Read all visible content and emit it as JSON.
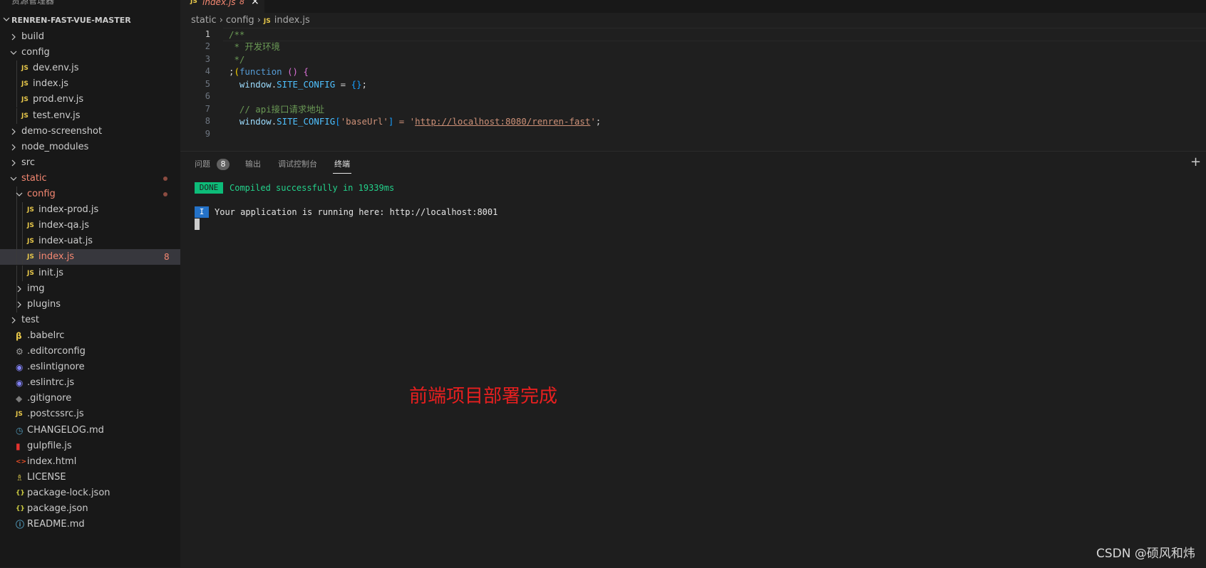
{
  "sidebar": {
    "title": "资源管理器",
    "more": "···",
    "root": "RENREN-FAST-VUE-MASTER",
    "items": [
      {
        "label": "build",
        "icon": "chevron-right-icon"
      },
      {
        "label": "config",
        "icon": "chevron-down-icon"
      },
      {
        "label": "dev.env.js",
        "icon": "js-file-icon",
        "icon_text": "JS"
      },
      {
        "label": "index.js",
        "icon": "js-file-icon",
        "icon_text": "JS"
      },
      {
        "label": "prod.env.js",
        "icon": "js-file-icon",
        "icon_text": "JS"
      },
      {
        "label": "test.env.js",
        "icon": "js-file-icon",
        "icon_text": "JS"
      },
      {
        "label": "demo-screenshot",
        "icon": "chevron-right-icon"
      },
      {
        "label": "node_modules",
        "icon": "chevron-right-icon"
      },
      {
        "label": "src",
        "icon": "chevron-right-icon"
      },
      {
        "label": "static",
        "icon": "chevron-down-icon",
        "modified": true
      },
      {
        "label": "config",
        "icon": "chevron-down-icon",
        "modified": true
      },
      {
        "label": "index-prod.js",
        "icon": "js-file-icon",
        "icon_text": "JS"
      },
      {
        "label": "index-qa.js",
        "icon": "js-file-icon",
        "icon_text": "JS"
      },
      {
        "label": "index-uat.js",
        "icon": "js-file-icon",
        "icon_text": "JS"
      },
      {
        "label": "index.js",
        "icon": "js-file-icon",
        "icon_text": "JS",
        "badge": "8"
      },
      {
        "label": "init.js",
        "icon": "js-file-icon",
        "icon_text": "JS"
      },
      {
        "label": "img",
        "icon": "chevron-right-icon"
      },
      {
        "label": "plugins",
        "icon": "chevron-right-icon"
      },
      {
        "label": "test",
        "icon": "chevron-right-icon"
      },
      {
        "label": ".babelrc",
        "icon": "babel-icon"
      },
      {
        "label": ".editorconfig",
        "icon": "gear-icon"
      },
      {
        "label": ".eslintignore",
        "icon": "eslint-icon"
      },
      {
        "label": ".eslintrc.js",
        "icon": "eslint-icon"
      },
      {
        "label": ".gitignore",
        "icon": "git-icon"
      },
      {
        "label": ".postcssrc.js",
        "icon": "js-file-icon",
        "icon_text": "JS"
      },
      {
        "label": "CHANGELOG.md",
        "icon": "clock-icon"
      },
      {
        "label": "gulpfile.js",
        "icon": "gulp-icon"
      },
      {
        "label": "index.html",
        "icon": "html-icon",
        "icon_text": "<>"
      },
      {
        "label": "LICENSE",
        "icon": "license-icon"
      },
      {
        "label": "package-lock.json",
        "icon": "json-icon",
        "icon_text": "{}"
      },
      {
        "label": "package.json",
        "icon": "json-icon",
        "icon_text": "{}"
      },
      {
        "label": "README.md",
        "icon": "info-icon"
      }
    ]
  },
  "editor": {
    "tab": {
      "icon_text": "JS",
      "label": "index.js",
      "badge": "8",
      "close": "×"
    },
    "breadcrumb": {
      "parts": [
        "static",
        "config"
      ],
      "file": "index.js",
      "file_icon_text": "JS"
    },
    "lines": [
      "1",
      "2",
      "3",
      "4",
      "5",
      "6",
      "7",
      "8",
      "9"
    ],
    "code": {
      "l1": "/**",
      "l2": " * 开发环境",
      "l3": " */",
      "l4a": ";",
      "l4b": "(",
      "l4c": "function",
      "l4d": " ",
      "l4e": "()",
      "l4f": " {",
      "l5a": "  window",
      "l5b": ".",
      "l5c": "SITE_CONFIG",
      "l5d": " = ",
      "l5e": "{}",
      "l5f": ";",
      "l7": "  // api接口请求地址",
      "l8a": "  window",
      "l8b": ".",
      "l8c": "SITE_CONFIG",
      "l8d": "[",
      "l8e": "'baseUrl'",
      "l8f": "]",
      "l8g": " = '",
      "l8h": "http://localhost:8080/renren-fast",
      "l8i": "'",
      "l8j": ";"
    }
  },
  "panel": {
    "tabs": {
      "problems": "问题",
      "problems_count": "8",
      "output": "输出",
      "debug": "调试控制台",
      "terminal": "终端"
    },
    "plus": "+",
    "terminal": {
      "done_badge": "DONE",
      "done_text": "Compiled successfully in 19339ms",
      "info_badge": "I",
      "run_text": "Your application is running here: http://localhost:8001"
    }
  },
  "annotation": "前端项目部署完成",
  "watermark": "CSDN @硕风和炜",
  "colors": {
    "accent_red": "#e81f1f",
    "done_green": "#0dbc79",
    "info_blue": "#2472c8",
    "js_yellow": "#e8c84a",
    "error_red": "#f48771"
  }
}
